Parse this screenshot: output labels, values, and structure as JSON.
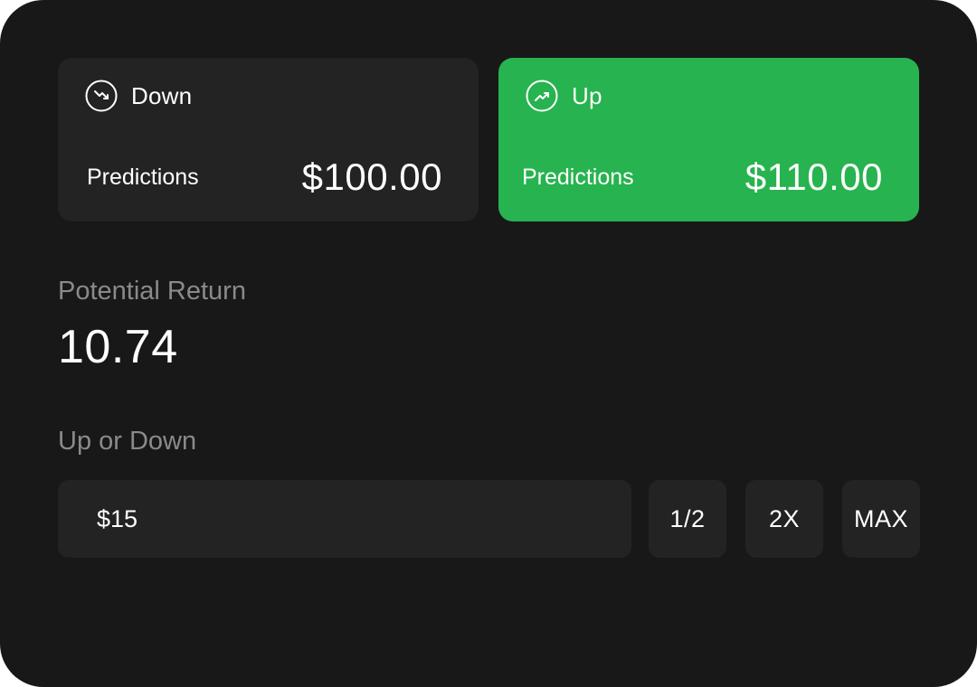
{
  "cards": {
    "down": {
      "label": "Down",
      "predictions_label": "Predictions",
      "predictions_value": "$100.00",
      "icon": "trend-down-icon"
    },
    "up": {
      "label": "Up",
      "predictions_label": "Predictions",
      "predictions_value": "$110.00",
      "icon": "trend-up-icon",
      "selected": true
    }
  },
  "potential_return": {
    "label": "Potential Return",
    "value": "10.74"
  },
  "wager": {
    "label": "Up or Down",
    "amount": "$15",
    "buttons": {
      "half": "1/2",
      "double": "2X",
      "max": "MAX"
    }
  },
  "colors": {
    "background": "#181818",
    "card": "#232323",
    "accent_green": "#27b34f",
    "muted_text": "#8a8a8a",
    "text": "#ffffff"
  }
}
